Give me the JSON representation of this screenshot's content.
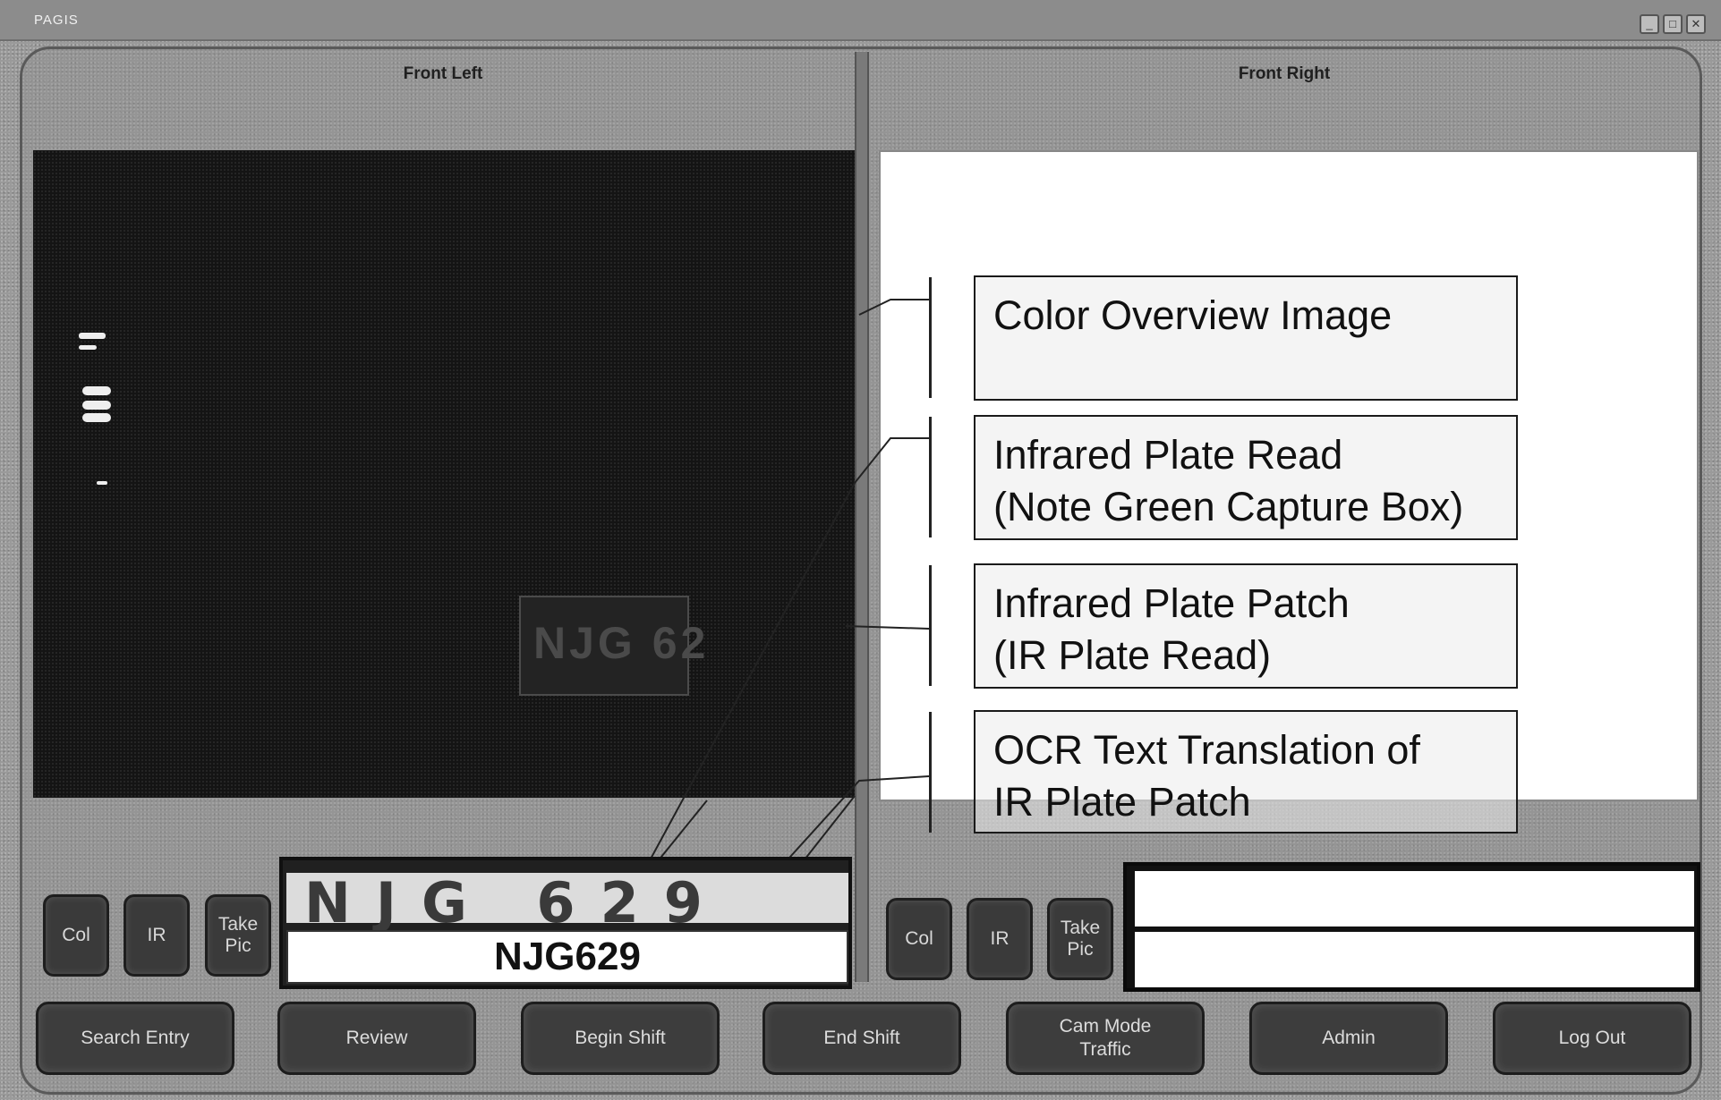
{
  "window": {
    "title": "PAGIS",
    "minimize": "_",
    "maximize": "□",
    "close": "✕"
  },
  "cameras": {
    "left": {
      "label": "Front Left",
      "buttons": {
        "col": "Col",
        "ir": "IR",
        "take_pic": "Take\nPic"
      },
      "plate_patch": "NJG 629",
      "ocr": "NJG629",
      "ir_box_text": "NJG 62"
    },
    "right": {
      "label": "Front Right",
      "buttons": {
        "col": "Col",
        "ir": "IR",
        "take_pic": "Take\nPic"
      },
      "plate_patch": "",
      "ocr": ""
    }
  },
  "annotations": {
    "color_overview": "Color Overview Image",
    "ir_plate_read_1": "Infrared Plate Read",
    "ir_plate_read_2": "(Note Green Capture Box)",
    "ir_plate_patch_1": "Infrared Plate Patch",
    "ir_plate_patch_2": "(IR Plate Read)",
    "ocr_1": "OCR Text Translation of",
    "ocr_2": "IR Plate Patch"
  },
  "nav": {
    "search_entry": "Search Entry",
    "review": "Review",
    "begin_shift": "Begin Shift",
    "end_shift": "End Shift",
    "cam_mode": "Cam Mode\nTraffic",
    "admin": "Admin",
    "log_out": "Log Out"
  },
  "colors": {
    "button_bg": "#3d3d3d",
    "frame": "#9a9a9a",
    "image_bg": "#141414"
  }
}
